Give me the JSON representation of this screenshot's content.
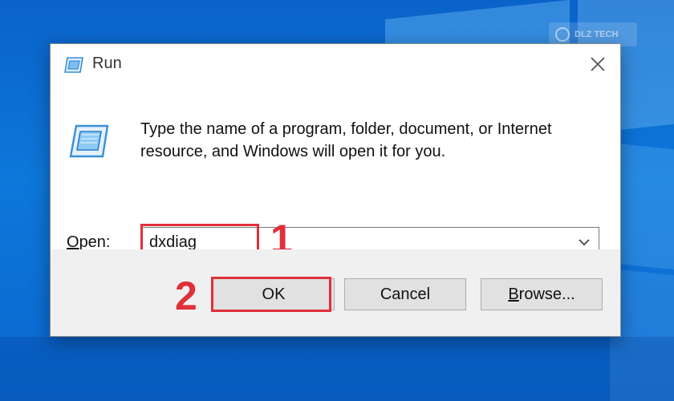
{
  "watermark": {
    "text": "DLZ TECH"
  },
  "dialog": {
    "title": "Run",
    "description": "Type the name of a program, folder, document, or Internet resource, and Windows will open it for you.",
    "open_label_accel": "O",
    "open_label_rest": "pen:",
    "open_value": "dxdiag"
  },
  "buttons": {
    "ok": "OK",
    "cancel": "Cancel",
    "browse_accel": "B",
    "browse_rest": "rowse..."
  },
  "annotations": {
    "step1": "1",
    "step2": "2"
  },
  "colors": {
    "annotation_red": "#e0303a",
    "desktop_blue": "#0d77da"
  },
  "icons": {
    "title": "run-icon",
    "body": "run-icon-large",
    "close": "close-icon",
    "chevron": "chevron-down-icon"
  }
}
